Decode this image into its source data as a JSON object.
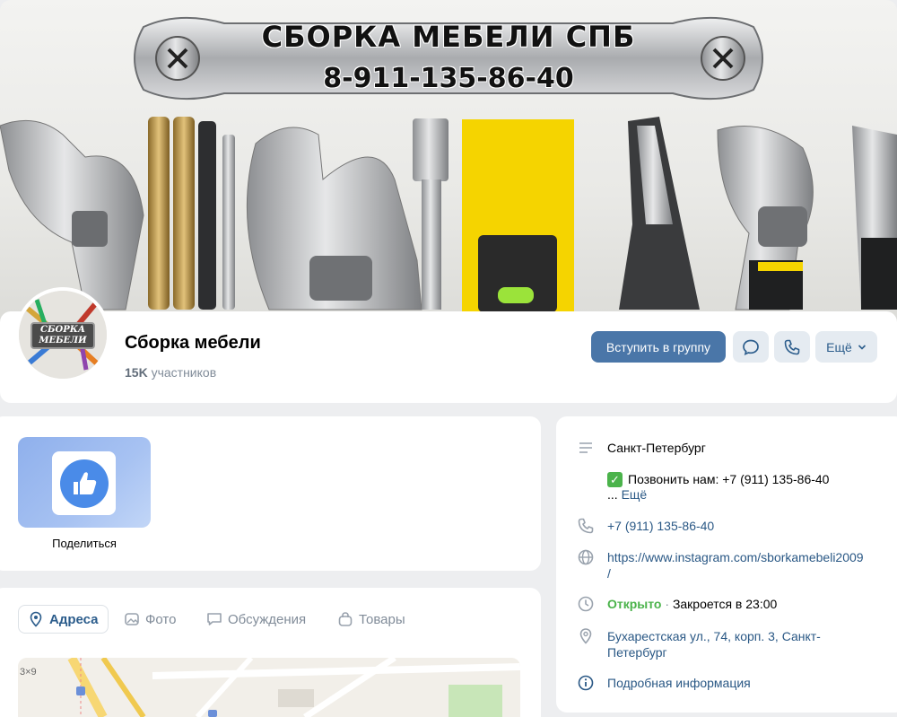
{
  "cover": {
    "banner_title": "СБОРКА МЕБЕЛИ СПБ",
    "banner_phone": "8-911-135-86-40",
    "accent_yellow": "#f5d400",
    "metal_grey": "#a7a9ac"
  },
  "group": {
    "avatar_text_1": "СБОРКА",
    "avatar_text_2": "МЕБЕЛИ",
    "name": "Сборка мебели",
    "members_count": "15K",
    "members_label": "участников",
    "join_label": "Вступить в группу",
    "more_label": "Ещё"
  },
  "share": {
    "label": "Поделиться"
  },
  "tabs": [
    {
      "label": "Адреса",
      "icon": "location-pin-icon"
    },
    {
      "label": "Фото",
      "icon": "photo-icon"
    },
    {
      "label": "Обсуждения",
      "icon": "chat-bubble-icon"
    },
    {
      "label": "Товары",
      "icon": "shopping-bag-icon"
    }
  ],
  "map": {
    "label": "3×9"
  },
  "info": {
    "city": "Санкт-Петербург",
    "call_line": "Позвонить нам: +7 (911) 135-86-40",
    "more_prefix": "... ",
    "more_link": "Ещё",
    "phone": "+7 (911) 135-86-40",
    "website_line1": "https://www.instagram.com/sborkamebeli2009",
    "website_line2": "/",
    "open_status": "Открыто",
    "separator": " · ",
    "closes": "Закроется в 23:00",
    "address_line1": "Бухарестская ул., 74, корп. 3, Санкт-",
    "address_line2": "Петербург",
    "details_link": "Подробная информация"
  },
  "colors": {
    "brand_blue": "#4a76a8",
    "link_blue": "#2a5885",
    "open_green": "#4bb34b",
    "page_bg": "#edeef0"
  }
}
